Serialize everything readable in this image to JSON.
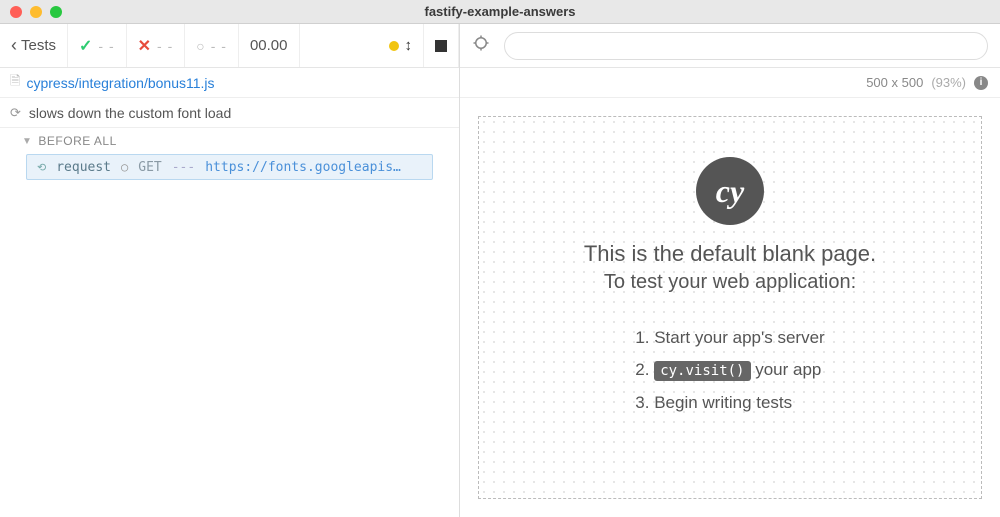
{
  "window": {
    "title": "fastify-example-answers"
  },
  "toolbar": {
    "tests_label": "Tests",
    "pass_dashes": "- -",
    "fail_dashes": "- -",
    "pending_dashes": "- -",
    "timer": "00.00"
  },
  "file": {
    "path": "cypress/integration/bonus11.js"
  },
  "test": {
    "name": "slows down the custom font load"
  },
  "hook": {
    "label": "BEFORE ALL"
  },
  "command": {
    "name": "request",
    "method": "GET",
    "dashes": "---",
    "url": "https://fonts.googleapis…"
  },
  "viewport": {
    "size": "500 x 500",
    "scale": "(93%)"
  },
  "url_input": {
    "value": ""
  },
  "aut": {
    "line1": "This is the default blank page.",
    "line2": "To test your web application:",
    "steps": {
      "s1": "Start your app's server",
      "s2a": "cy.visit()",
      "s2b": " your app",
      "s3": "Begin writing tests"
    }
  }
}
